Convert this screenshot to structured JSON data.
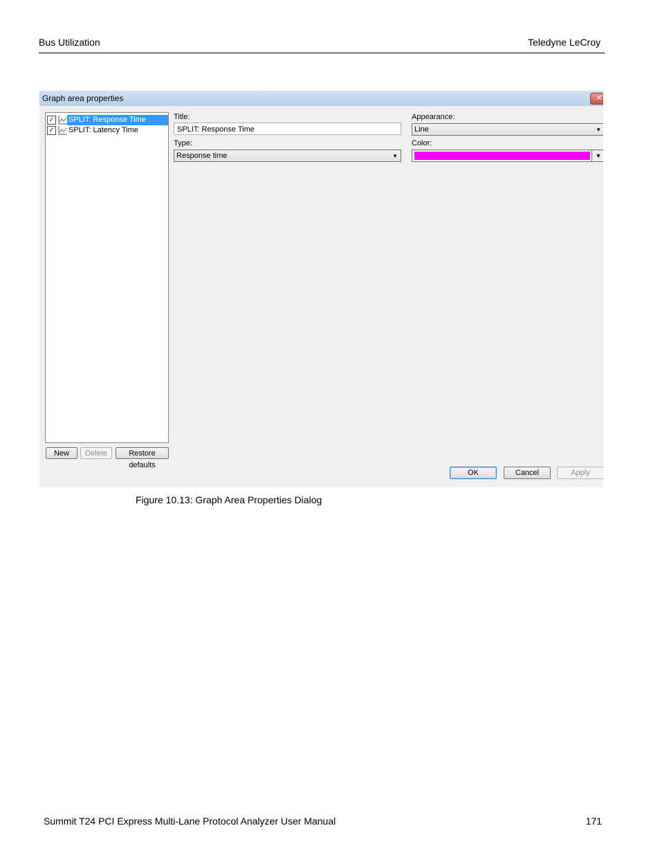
{
  "page": {
    "header_left": "Bus Utilization",
    "header_right": "Teledyne LeCroy",
    "caption": "Figure 10.13:  Graph Area Properties Dialog",
    "footer_left": "Summit T24 PCI Express Multi-Lane Protocol Analyzer User Manual",
    "footer_right": "171"
  },
  "dialog": {
    "title": "Graph area properties",
    "close_icon": "close-icon",
    "series_list": [
      {
        "label": "SPLIT: Response Time",
        "checked": true,
        "selected": true,
        "icon": "line-graph-icon"
      },
      {
        "label": "SPLIT: Latency Time",
        "checked": true,
        "selected": false,
        "icon": "line-graph-icon"
      }
    ],
    "buttons": {
      "new": "New",
      "delete": "Delete",
      "restore_defaults": "Restore defaults",
      "ok": "OK",
      "cancel": "Cancel",
      "apply": "Apply"
    },
    "fields": {
      "title_label": "Title:",
      "title_value": "SPLIT: Response Time",
      "type_label": "Type:",
      "type_value": "Response time",
      "appearance_label": "Appearance:",
      "appearance_value": "Line",
      "color_label": "Color:",
      "color_value": "#ff00ff"
    }
  },
  "colors": {
    "selection": "#3399ff",
    "titlebar": "#b9d1ea",
    "dialog_bg": "#f0f0f0"
  }
}
